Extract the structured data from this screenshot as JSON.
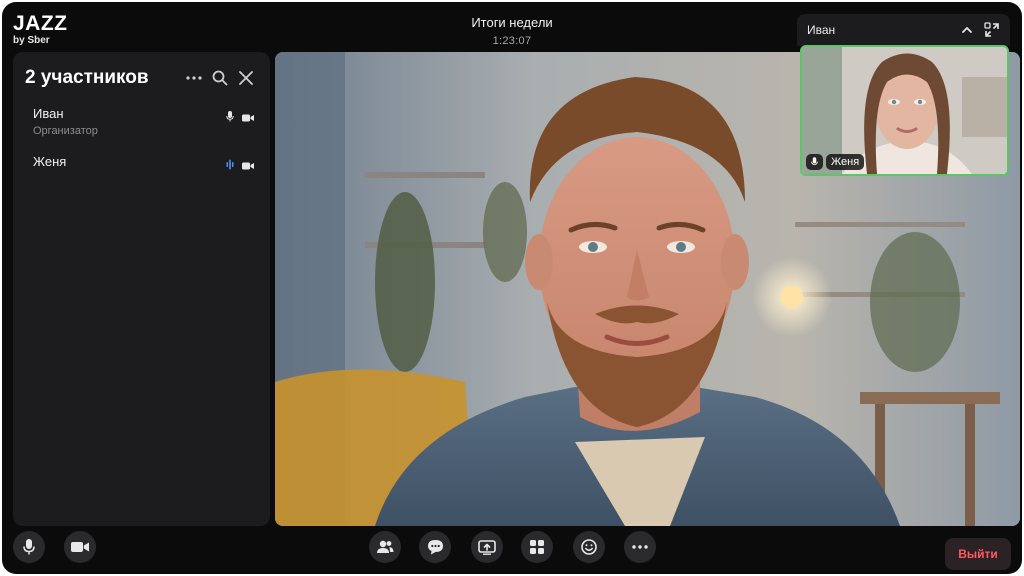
{
  "app": {
    "logo": "JAZZ",
    "logo_sub": "by Sber"
  },
  "meeting": {
    "title": "Итоги недели",
    "timer": "1:23:07"
  },
  "participants_panel": {
    "title": "2 участников",
    "items": [
      {
        "name": "Иван",
        "role": "Организатор",
        "mic": "mic-icon",
        "camera": "camera-icon"
      },
      {
        "name": "Женя",
        "role": "",
        "mic": "speaking-indicator-icon",
        "camera": "camera-icon"
      }
    ]
  },
  "pip": {
    "header_name": "Иван",
    "label": "Женя"
  },
  "controls": {
    "leave_label": "Выйти"
  },
  "colors": {
    "active_border": "#5cc46a",
    "leave_text": "#ff5a5f",
    "speaking": "#4a90ff"
  }
}
